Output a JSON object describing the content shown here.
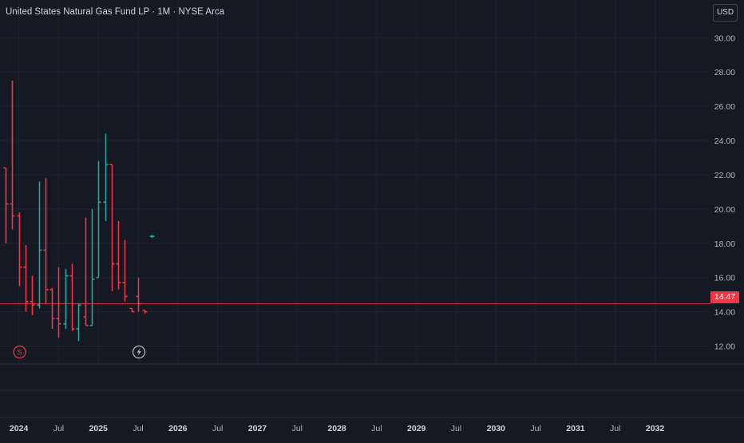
{
  "header": {
    "title": "United States Natural Gas Fund LP · 1M · NYSE Arca",
    "currency": "USD"
  },
  "last_price": {
    "label": "14.47",
    "value": 14.47
  },
  "markers": [
    {
      "name": "split-marker",
      "text": "S",
      "icon": "split-letter-icon",
      "color": "#f23645",
      "x": "2024-01"
    },
    {
      "name": "earnings-marker",
      "text": "",
      "icon": "lightning-icon",
      "color": "#b2b5be",
      "x": "2025-07"
    }
  ],
  "colors": {
    "background": "#151924",
    "up": "#26a69a",
    "down": "#f23645",
    "grid": "#1f2330",
    "axis_text": "#b2b5be"
  },
  "chart_data": {
    "type": "ohlc",
    "title": "United States Natural Gas Fund LP · 1M · NYSE Arca",
    "ylim": [
      11.0,
      30.9
    ],
    "yticks": [
      "12.00",
      "14.00",
      "16.00",
      "18.00",
      "20.00",
      "22.00",
      "24.00",
      "26.00",
      "28.00",
      "30.00"
    ],
    "xlim": [
      "2023-11",
      "2032-09"
    ],
    "xticks": [
      {
        "label": "2024",
        "x": "2024-01",
        "bold": true
      },
      {
        "label": "Jul",
        "x": "2024-07"
      },
      {
        "label": "2025",
        "x": "2025-01",
        "bold": true
      },
      {
        "label": "Jul",
        "x": "2025-07"
      },
      {
        "label": "2026",
        "x": "2026-01",
        "bold": true
      },
      {
        "label": "Jul",
        "x": "2026-07"
      },
      {
        "label": "2027",
        "x": "2027-01",
        "bold": true
      },
      {
        "label": "Jul",
        "x": "2027-07"
      },
      {
        "label": "2028",
        "x": "2028-01",
        "bold": true
      },
      {
        "label": "Jul",
        "x": "2028-07"
      },
      {
        "label": "2029",
        "x": "2029-01",
        "bold": true
      },
      {
        "label": "Jul",
        "x": "2029-07"
      },
      {
        "label": "2030",
        "x": "2030-01",
        "bold": true
      },
      {
        "label": "Jul",
        "x": "2030-07"
      },
      {
        "label": "2031",
        "x": "2031-01",
        "bold": true
      },
      {
        "label": "Jul",
        "x": "2031-07"
      },
      {
        "label": "2032",
        "x": "2032-01",
        "bold": true
      }
    ],
    "bars": [
      {
        "t": "2023-11",
        "o": 22.4,
        "h": 22.4,
        "l": 18.0,
        "c": 20.3
      },
      {
        "t": "2023-12",
        "o": 20.3,
        "h": 27.5,
        "l": 18.8,
        "c": 19.6
      },
      {
        "t": "2024-01",
        "o": 19.6,
        "h": 19.8,
        "l": 15.5,
        "c": 16.6
      },
      {
        "t": "2024-02",
        "o": 16.6,
        "h": 17.9,
        "l": 14.0,
        "c": 14.6
      },
      {
        "t": "2024-03",
        "o": 14.6,
        "h": 16.1,
        "l": 13.8,
        "c": 14.4
      },
      {
        "t": "2024-04",
        "o": 14.4,
        "h": 21.6,
        "l": 14.2,
        "c": 17.6
      },
      {
        "t": "2024-05",
        "o": 17.6,
        "h": 21.8,
        "l": 14.5,
        "c": 15.3
      },
      {
        "t": "2024-06",
        "o": 15.3,
        "h": 15.4,
        "l": 13.0,
        "c": 13.6
      },
      {
        "t": "2024-07",
        "o": 13.6,
        "h": 16.6,
        "l": 12.5,
        "c": 13.3
      },
      {
        "t": "2024-08",
        "o": 13.3,
        "h": 16.5,
        "l": 13.0,
        "c": 16.1
      },
      {
        "t": "2024-09",
        "o": 16.1,
        "h": 16.8,
        "l": 12.9,
        "c": 13.0
      },
      {
        "t": "2024-10",
        "o": 13.0,
        "h": 14.5,
        "l": 12.3,
        "c": 14.4
      },
      {
        "t": "2024-11",
        "o": 13.7,
        "h": 19.5,
        "l": 13.2,
        "c": 13.2
      },
      {
        "t": "2024-12",
        "o": 13.2,
        "h": 20.0,
        "l": 15.9,
        "c": 15.9
      },
      {
        "t": "2025-01",
        "o": 16.0,
        "h": 22.8,
        "l": 16.8,
        "c": 20.4
      },
      {
        "t": "2025-02",
        "o": 20.4,
        "h": 24.4,
        "l": 19.3,
        "c": 22.6
      },
      {
        "t": "2025-03",
        "o": 22.6,
        "h": 22.0,
        "l": 15.2,
        "c": 16.8
      },
      {
        "t": "2025-04",
        "o": 16.8,
        "h": 19.3,
        "l": 15.3,
        "c": 15.7
      },
      {
        "t": "2025-05",
        "o": 15.7,
        "h": 18.2,
        "l": 14.6,
        "c": 14.9
      },
      {
        "t": "2025-06",
        "o": 14.2,
        "h": 14.2,
        "l": 14.0,
        "c": 14.0
      },
      {
        "t": "2025-07",
        "o": 14.9,
        "h": 16.0,
        "l": 14.0,
        "c": 14.47
      },
      {
        "t": "2025-08",
        "o": 14.1,
        "h": 14.1,
        "l": 13.9,
        "c": 14.0
      },
      {
        "t": "2025-09",
        "o": 18.4,
        "h": 18.5,
        "l": 18.3,
        "c": 18.4
      }
    ]
  }
}
